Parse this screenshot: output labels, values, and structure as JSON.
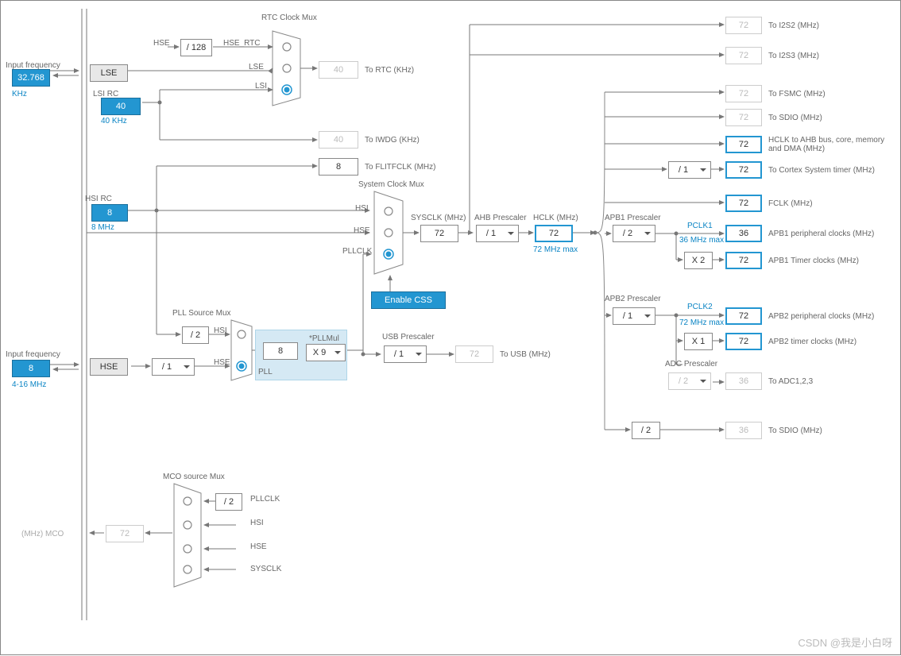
{
  "inputs": {
    "lse_freq_label": "Input frequency",
    "lse_freq": "32.768",
    "lse_unit": "KHz",
    "hse_freq_label": "Input frequency",
    "hse_freq": "8",
    "hse_range": "4-16 MHz",
    "hsi_label": "HSI RC",
    "hsi_val": "8",
    "hsi_unit": "8 MHz",
    "lsi_label": "LSI RC",
    "lsi_val": "40",
    "lsi_unit": "40 KHz",
    "lse_box": "LSE",
    "hse_box": "HSE"
  },
  "rtc": {
    "title": "RTC Clock Mux",
    "hse_div": "/ 128",
    "hse_sig": "HSE_RTC",
    "lse_sig": "LSE",
    "lsi_sig": "LSI",
    "out_val": "40",
    "out_label": "To RTC (KHz)",
    "iwdg_val": "40",
    "iwdg_label": "To IWDG (KHz)",
    "hse_in": "HSE"
  },
  "flitf": {
    "val": "8",
    "label": "To FLITFCLK (MHz)"
  },
  "sysclk": {
    "title": "System Clock Mux",
    "hsi": "HSI",
    "hse": "HSE",
    "pllclk": "PLLCLK",
    "sysclk_lbl": "SYSCLK (MHz)",
    "sysclk_val": "72",
    "enable_css": "Enable CSS"
  },
  "pll": {
    "title": "PLL Source Mux",
    "div2": "/ 2",
    "hsi": "HSI",
    "hse": "HSE",
    "hse_div": "/ 1",
    "pll_in": "8",
    "pllmul_lbl": "*PLLMul",
    "pllmul": "X 9",
    "pll_lbl": "PLL"
  },
  "usb": {
    "title": "USB Prescaler",
    "div": "/ 1",
    "val": "72",
    "label": "To USB (MHz)"
  },
  "ahb": {
    "title": "AHB Prescaler",
    "div": "/ 1",
    "hclk_lbl": "HCLK (MHz)",
    "hclk_val": "72",
    "hclk_max": "72 MHz max"
  },
  "apb1": {
    "title": "APB1 Prescaler",
    "div": "/ 2",
    "pclk1": "PCLK1",
    "pclk1_max": "36 MHz max",
    "mult": "X 2"
  },
  "apb2": {
    "title": "APB2 Prescaler",
    "div": "/ 1",
    "pclk2": "PCLK2",
    "pclk2_max": "72 MHz max",
    "mult": "X 1",
    "adc_title": "ADC Prescaler",
    "adc_div": "/ 2",
    "sdio_div": "/ 2"
  },
  "out": {
    "i2s2": {
      "v": "72",
      "l": "To I2S2 (MHz)"
    },
    "i2s3": {
      "v": "72",
      "l": "To I2S3 (MHz)"
    },
    "fsmc": {
      "v": "72",
      "l": "To FSMC (MHz)"
    },
    "sdio": {
      "v": "72",
      "l": "To SDIO (MHz)"
    },
    "hclk": {
      "v": "72",
      "l": "HCLK to AHB bus, core, memory and DMA (MHz)"
    },
    "systick": {
      "v": "72",
      "l": "To Cortex System timer (MHz)"
    },
    "systick_div": "/ 1",
    "fclk": {
      "v": "72",
      "l": "FCLK (MHz)"
    },
    "apb1p": {
      "v": "36",
      "l": "APB1 peripheral clocks (MHz)"
    },
    "apb1t": {
      "v": "72",
      "l": "APB1 Timer clocks (MHz)"
    },
    "apb2p": {
      "v": "72",
      "l": "APB2 peripheral clocks (MHz)"
    },
    "apb2t": {
      "v": "72",
      "l": "APB2 timer clocks (MHz)"
    },
    "adc": {
      "v": "36",
      "l": "To ADC1,2,3"
    },
    "sdio2": {
      "v": "36",
      "l": "To SDIO (MHz)"
    }
  },
  "mco": {
    "title": "MCO source Mux",
    "pllclk": "PLLCLK",
    "div2": "/ 2",
    "hsi": "HSI",
    "hse": "HSE",
    "sysclk": "SYSCLK",
    "val": "72",
    "label": "(MHz) MCO"
  },
  "watermark": "CSDN @我是小白呀"
}
